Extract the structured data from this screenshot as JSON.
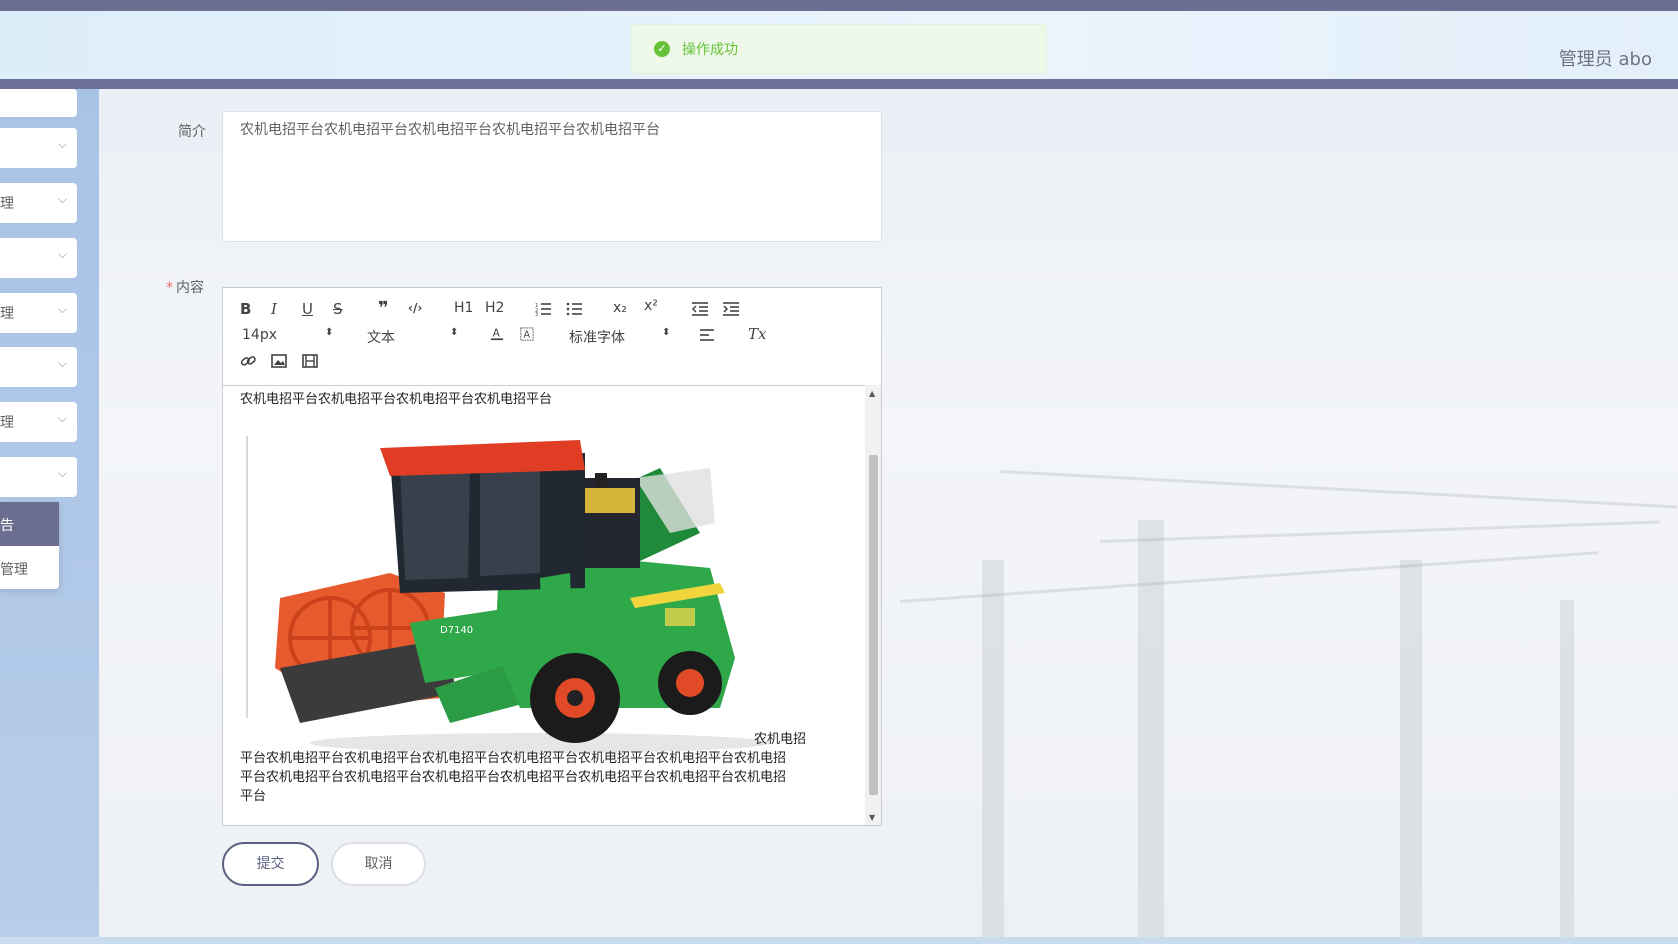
{
  "header": {
    "user_label": "管理员 abo"
  },
  "toast": {
    "icon": "check-circle-icon",
    "message": "操作成功",
    "color": "#67c23a"
  },
  "sidebar": {
    "items": [
      {
        "label": "",
        "has_chevron": false
      },
      {
        "label": "",
        "has_chevron": true
      },
      {
        "label": "理",
        "has_chevron": true
      },
      {
        "label": "",
        "has_chevron": true
      },
      {
        "label": "理",
        "has_chevron": true
      },
      {
        "label": "",
        "has_chevron": true
      },
      {
        "label": "理",
        "has_chevron": true
      },
      {
        "label": "",
        "has_chevron": true
      }
    ],
    "submenu": {
      "active_label": "告",
      "other_label": "管理"
    },
    "active_color": "#6b6e91"
  },
  "form": {
    "summary_label": "简介",
    "summary_value": "农机电招平台农机电招平台农机电招平台农机电招平台农机电招平台",
    "content_label": "内容",
    "content_required_mark": "*"
  },
  "editor": {
    "toolbar": {
      "bold": "B",
      "italic": "I",
      "underline": "U",
      "strike": "S",
      "blockquote": "❞",
      "code": "‹/›",
      "h1": "H1",
      "h2": "H2",
      "subscript": "x₂",
      "superscript": "x²",
      "font_size": "14px",
      "header_select": "文本",
      "font_family": "标准字体",
      "clean": "Tx"
    },
    "first_line": "农机电招平台农机电招平台农机电招平台农机电招平台",
    "after_image_text": "农机电招",
    "lines": [
      "平台农机电招平台农机电招平台农机电招平台农机电招平台农机电招平台农机电招平台农机电招",
      "平台农机电招平台农机电招平台农机电招平台农机电招平台农机电招平台农机电招平台农机电招",
      "平台"
    ],
    "image_alt": "green-combine-harvester-image"
  },
  "actions": {
    "submit_label": "提交",
    "cancel_label": "取消",
    "submit_color": "#5b5e83"
  }
}
